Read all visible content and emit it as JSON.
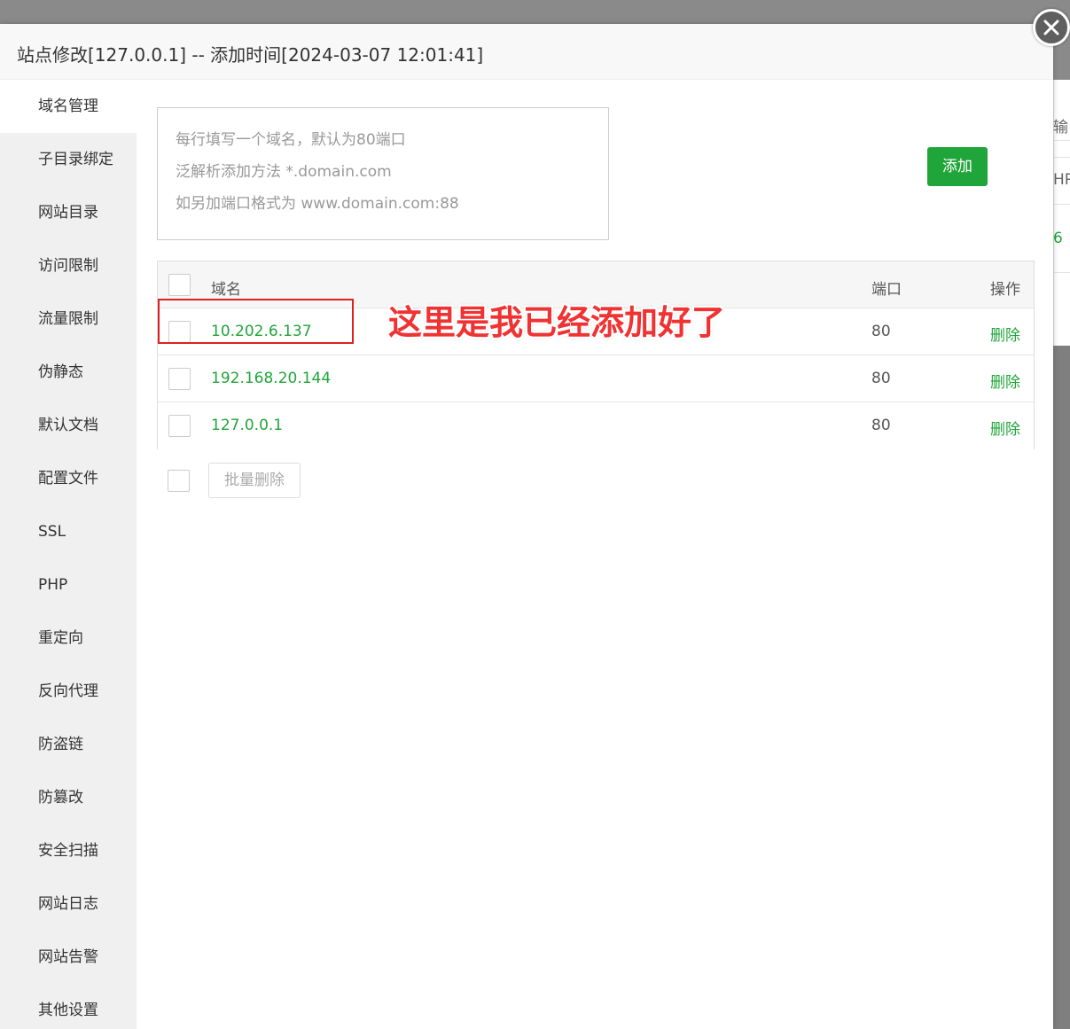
{
  "background_fragments": {
    "frag1": "输",
    "frag2": "HP",
    "frag3": "6"
  },
  "dialog": {
    "title": "站点修改[127.0.0.1] -- 添加时间[2024-03-07 12:01:41]",
    "close_icon": "close-icon"
  },
  "sidebar": {
    "items": [
      {
        "label": "域名管理",
        "active": true
      },
      {
        "label": "子目录绑定"
      },
      {
        "label": "网站目录"
      },
      {
        "label": "访问限制"
      },
      {
        "label": "流量限制"
      },
      {
        "label": "伪静态"
      },
      {
        "label": "默认文档"
      },
      {
        "label": "配置文件"
      },
      {
        "label": "SSL"
      },
      {
        "label": "PHP"
      },
      {
        "label": "重定向"
      },
      {
        "label": "反向代理"
      },
      {
        "label": "防盗链"
      },
      {
        "label": "防篡改"
      },
      {
        "label": "安全扫描"
      },
      {
        "label": "网站日志"
      },
      {
        "label": "网站告警"
      },
      {
        "label": "其他设置"
      }
    ]
  },
  "domain_input": {
    "placeholder_lines": [
      "每行填写一个域名，默认为80端口",
      "泛解析添加方法 *.domain.com",
      "如另加端口格式为 www.domain.com:88"
    ]
  },
  "add_button": "添加",
  "table": {
    "headers": {
      "domain": "域名",
      "port": "端口",
      "op": "操作"
    },
    "rows": [
      {
        "domain": "10.202.6.137",
        "port": "80",
        "op": "删除"
      },
      {
        "domain": "192.168.20.144",
        "port": "80",
        "op": "删除"
      },
      {
        "domain": "127.0.0.1",
        "port": "80",
        "op": "删除"
      }
    ]
  },
  "annotation": "这里是我已经添加好了",
  "bulk_delete_button": "批量删除",
  "colors": {
    "accent_green": "#20a53a",
    "annotation_red": "#f03232"
  }
}
